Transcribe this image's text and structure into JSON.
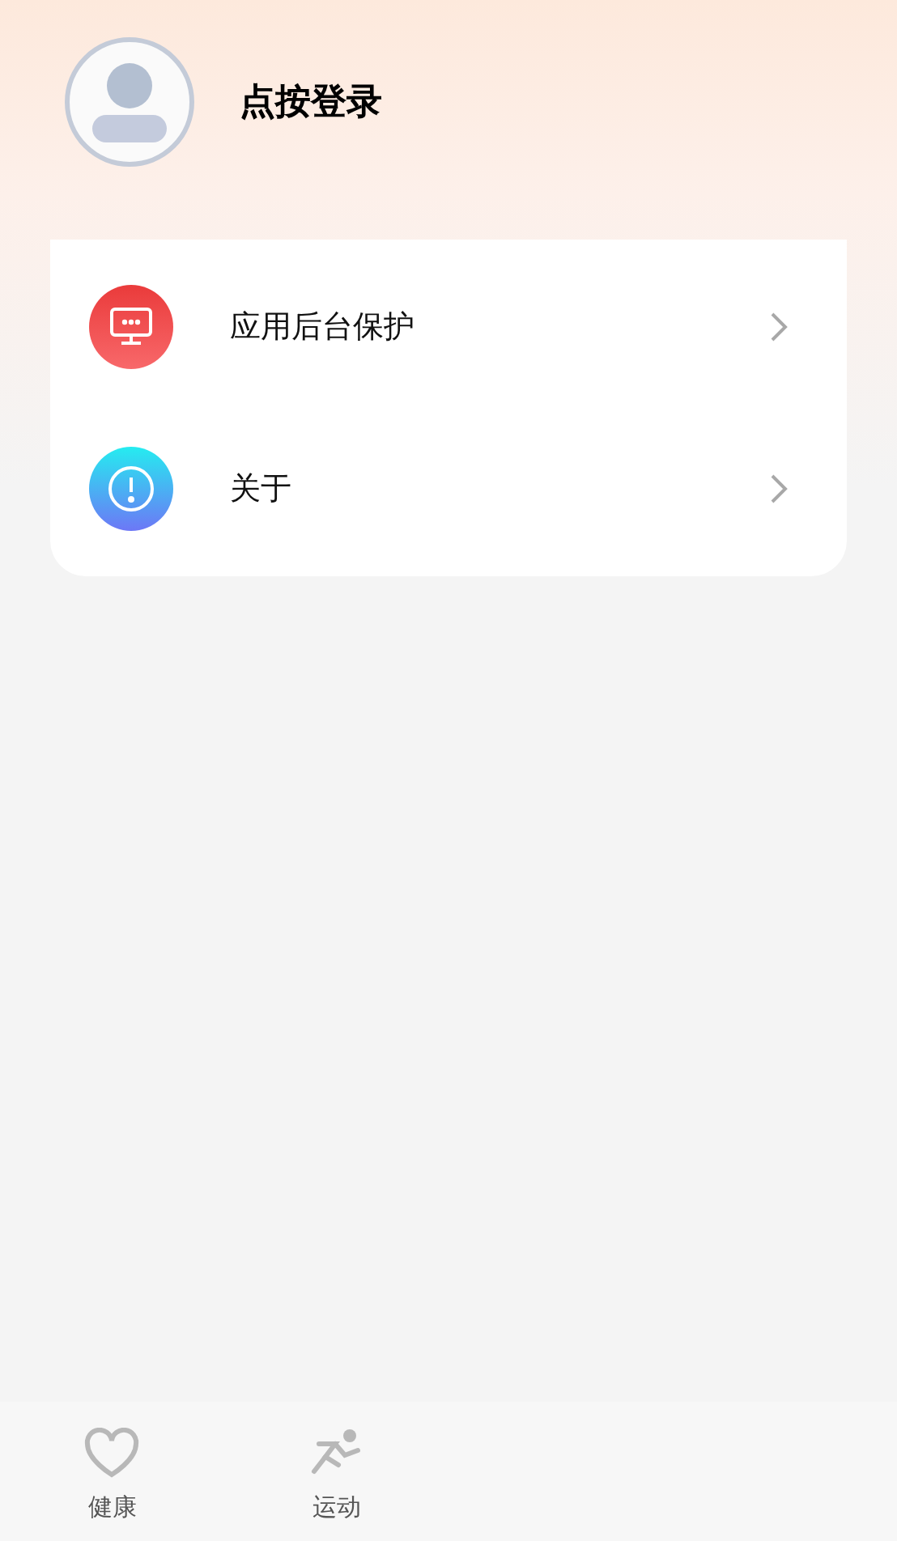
{
  "profile": {
    "login_label": "点按登录"
  },
  "menu": [
    {
      "kind": "protection",
      "label": "应用后台保护"
    },
    {
      "kind": "about",
      "label": "关于"
    }
  ],
  "tab_bar": [
    {
      "kind": "health",
      "label": "健康"
    },
    {
      "kind": "sport",
      "label": "运动"
    }
  ]
}
